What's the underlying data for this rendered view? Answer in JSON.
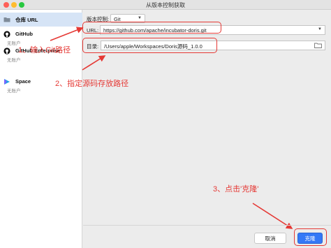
{
  "window": {
    "title": "从版本控制获取"
  },
  "sidebar": {
    "items": [
      {
        "label": "仓库 URL",
        "sub": ""
      },
      {
        "label": "GitHub",
        "sub": "无账户"
      },
      {
        "label": "GitHub Enterprise",
        "sub": "无账户"
      },
      {
        "label": "Space",
        "sub": "无账户"
      }
    ]
  },
  "form": {
    "vcs_label": "版本控制:",
    "vcs_value": "Git",
    "url_label": "URL:",
    "url_value": "https://github.com/apache/incubator-doris.git",
    "dir_label": "目录:",
    "dir_value": "/Users/apple/Workspaces/Doris源码_1.0.0"
  },
  "annotations": {
    "step1": "1、输入Git路径",
    "step2": "2、指定源码存放路径",
    "step3": "3、点击'克隆'",
    "color": "#e53935"
  },
  "buttons": {
    "cancel": "取消",
    "clone": "克隆"
  },
  "colors": {
    "primary_button": "#3478f6",
    "selected_item": "#d6e4f6"
  }
}
